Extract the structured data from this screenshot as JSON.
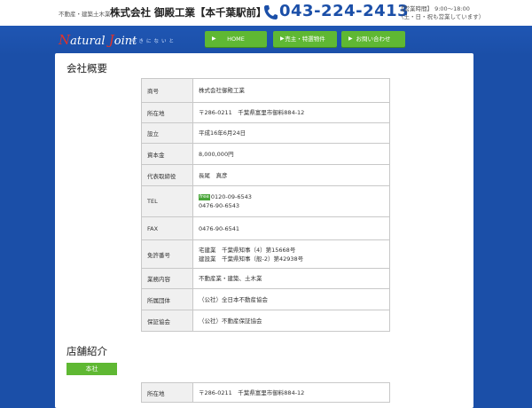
{
  "topbar": {
    "subtitle": "不動産・建築土木業",
    "company": "株式会社 御殿工業【本千葉駅前】",
    "phone_icon": "phone-icon",
    "phone": "043-224-2413",
    "hours_line1": "【営業時間】 9:00～18:00",
    "hours_line2": "（土・日・祝も営業しています）"
  },
  "header": {
    "logo_cap1": "N",
    "logo_rest1": "atural ",
    "logo_cap2": "J",
    "logo_rest2": "oint",
    "logo_kana": "ゆきにないと"
  },
  "nav": {
    "arrow": "▶",
    "items": [
      {
        "label": "HOME"
      },
      {
        "label": "売主・特選物件"
      },
      {
        "label": "お問い合わせ"
      }
    ]
  },
  "colors": {
    "brand_blue": "#1b4fa8",
    "accent_green": "#5fb833",
    "logo_red": "#e0322a"
  },
  "company_section": {
    "title": "会社概要",
    "rows": [
      {
        "key": "商号",
        "value": "株式会社御殿工業"
      },
      {
        "key": "所在地",
        "value": "〒286-0211　千葉県富里市御料884-12"
      },
      {
        "key": "設立",
        "value": "平成16年6月24日"
      },
      {
        "key": "資本金",
        "value": "8,000,000円"
      },
      {
        "key": "代表取締役",
        "value": "長尾　真彦"
      },
      {
        "key": "TEL",
        "badge": "free",
        "value_line1": "0120-09-6543",
        "value_line2": "0476-90-6543"
      },
      {
        "key": "FAX",
        "value": "0476-90-6541"
      },
      {
        "key": "免許番号",
        "value_line1": "宅建業　千葉県知事（4）第15668号",
        "value_line2": "建設業　千葉県知事（般-2）第42938号"
      },
      {
        "key": "業務内容",
        "value": "不動産業・建築、土木業"
      },
      {
        "key": "所属団体",
        "value": "（公社）全日本不動産協会"
      },
      {
        "key": "保証協会",
        "value": "（公社）不動産保証協会"
      }
    ]
  },
  "store_section": {
    "title": "店舗紹介",
    "tag": "本社",
    "rows": [
      {
        "key": "所在地",
        "value": "〒286-0211　千葉県富里市御料884-12"
      }
    ]
  }
}
